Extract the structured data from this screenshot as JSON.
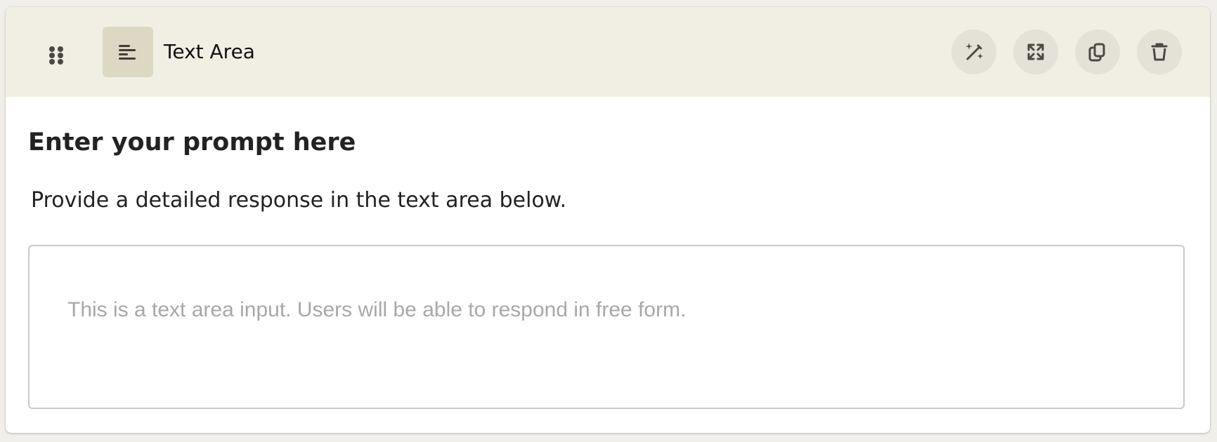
{
  "header": {
    "field_type": "Text Area",
    "type_icon": "text-align-left-icon",
    "drag_icon": "drag-handle-icon",
    "actions": [
      {
        "name": "magic-wand-button",
        "icon": "magic-wand-icon"
      },
      {
        "name": "expand-button",
        "icon": "expand-arrows-icon"
      },
      {
        "name": "copy-button",
        "icon": "copy-icon"
      },
      {
        "name": "delete-button",
        "icon": "trash-icon"
      }
    ]
  },
  "prompt": {
    "title": "Enter your prompt here",
    "description": "Provide a detailed response in the text area below."
  },
  "textarea": {
    "placeholder": "This is a text area input. Users will be able to respond in free form.",
    "value": ""
  },
  "colors": {
    "header_background": "#f1efe4",
    "icon_box_background": "#ddd8c4",
    "action_button_background": "#e4e1d7",
    "border": "#c9c9c9",
    "placeholder_text": "#a8a8a8"
  }
}
